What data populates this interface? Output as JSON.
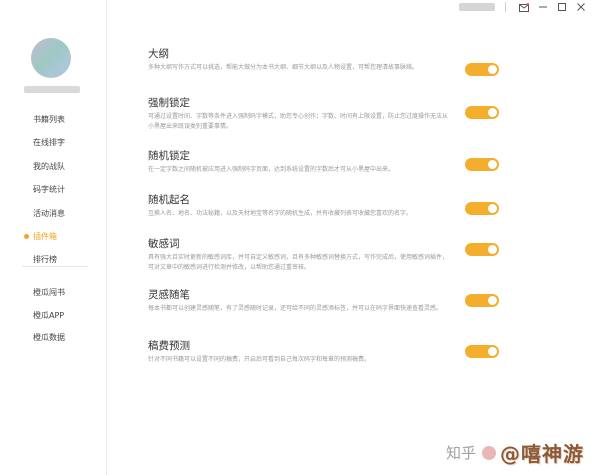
{
  "titlebar": {
    "icons": [
      "mail-icon",
      "minimize-icon",
      "maximize-icon",
      "close-icon"
    ]
  },
  "sidebar": {
    "items": [
      {
        "label": "书籍列表",
        "active": false
      },
      {
        "label": "在线排字",
        "active": false
      },
      {
        "label": "我的战队",
        "active": false
      },
      {
        "label": "码字统计",
        "active": false
      },
      {
        "label": "活动消息",
        "active": false
      },
      {
        "label": "插件箱",
        "active": true
      },
      {
        "label": "排行榜",
        "active": false
      }
    ],
    "secondary_items": [
      {
        "label": "橙瓜闯书"
      },
      {
        "label": "橙瓜APP"
      },
      {
        "label": "橙瓜数据"
      }
    ]
  },
  "settings": [
    {
      "title": "大纲",
      "desc": "多种大纲写作方式可以挑选，帮能大做分为本书大纲、细节大纲以及人物设置，可帮您理清故事脉络。",
      "enabled": true
    },
    {
      "title": "强制锁定",
      "desc": "可通过设置时间、字数等条件进入强制码字模式，助您专心创作；字数、时间有上限设置，防止您过度操作无法从小黑屋出来既误类别重要事情。",
      "enabled": true
    },
    {
      "title": "随机锁定",
      "desc": "在一定字数之间随机被应用进入强制码字页面，达到系统设置的字数后才可从小黑屋中出来。",
      "enabled": true
    },
    {
      "title": "随机起名",
      "desc": "互换人名、地名、功法秘籍，以及天材地宝等名字的随机生成，并有收藏列表可收藏您喜欢的名字。",
      "enabled": true
    },
    {
      "title": "敏感词",
      "desc": "具有强大且实时更新的敏感词库，并可自定义敏感词，且有多种敏感词替换方式，写作完成后，使用敏感词插件，可对文章中的敏感词进行检测并修改，以帮助您通过重审核。",
      "enabled": true
    },
    {
      "title": "灵感随笔",
      "desc": "每本书都可以创建灵感随笔，有了灵感随时记录，还可给不同的灵感添标签，并可以在码字界面快速查看灵感。",
      "enabled": true
    },
    {
      "title": "稿费预测",
      "desc": "针对不同书籍可以设置不同的稿费，开启后可看到自己每次码字和每章的预测稿费。",
      "enabled": true
    }
  ],
  "watermark": {
    "site": "知乎",
    "author": "@嘻神游"
  },
  "colors": {
    "accent": "#f5a623",
    "toggle_on": "#f4ae2e"
  }
}
